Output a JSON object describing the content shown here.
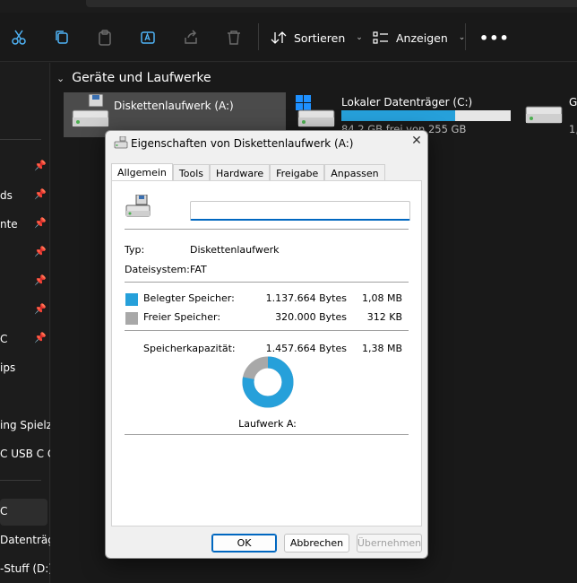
{
  "toolbar": {
    "sort_label": "Sortieren",
    "view_label": "Anzeigen",
    "more_label": "•••"
  },
  "sidebar": {
    "items": [
      {
        "label": "ds"
      },
      {
        "label": "nte"
      },
      {
        "label": "C"
      },
      {
        "label": "ips"
      },
      {
        "label": "ing Spielze"
      },
      {
        "label": "C USB C C"
      },
      {
        "label": "C"
      },
      {
        "label": " Datenträg"
      },
      {
        "label": "-Stuff (D:)"
      }
    ]
  },
  "main": {
    "section_title": "Geräte und Laufwerke",
    "drives": [
      {
        "name": "Diskettenlaufwerk (A:)"
      },
      {
        "name": "Lokaler Datenträger (C:)",
        "sub": "84,2 GB frei von 255 GB",
        "used_fraction": 0.67
      },
      {
        "name": "G",
        "sub": "1,"
      }
    ]
  },
  "dialog": {
    "title": "Eigenschaften von Diskettenlaufwerk (A:)",
    "close_label": "✕",
    "tabs": [
      "Allgemein",
      "Tools",
      "Hardware",
      "Freigabe",
      "Anpassen"
    ],
    "name_value": "",
    "type_label": "Typ:",
    "type_value": "Diskettenlaufwerk",
    "fs_label": "Dateisystem:",
    "fs_value": "FAT",
    "used_label": "Belegter Speicher:",
    "used_bytes": "1.137.664 Bytes",
    "used_size": "1,08 MB",
    "free_label": "Freier Speicher:",
    "free_bytes": "320.000 Bytes",
    "free_size": "312 KB",
    "cap_label": "Speicherkapazität:",
    "cap_bytes": "1.457.664 Bytes",
    "cap_size": "1,38 MB",
    "used_fraction": 0.7805,
    "drive_label": "Laufwerk A:",
    "ok_label": "OK",
    "cancel_label": "Abbrechen",
    "apply_label": "Übernehmen"
  },
  "colors": {
    "used": "#26a0da",
    "free": "#a8a8a8",
    "accent": "#0067c0"
  }
}
